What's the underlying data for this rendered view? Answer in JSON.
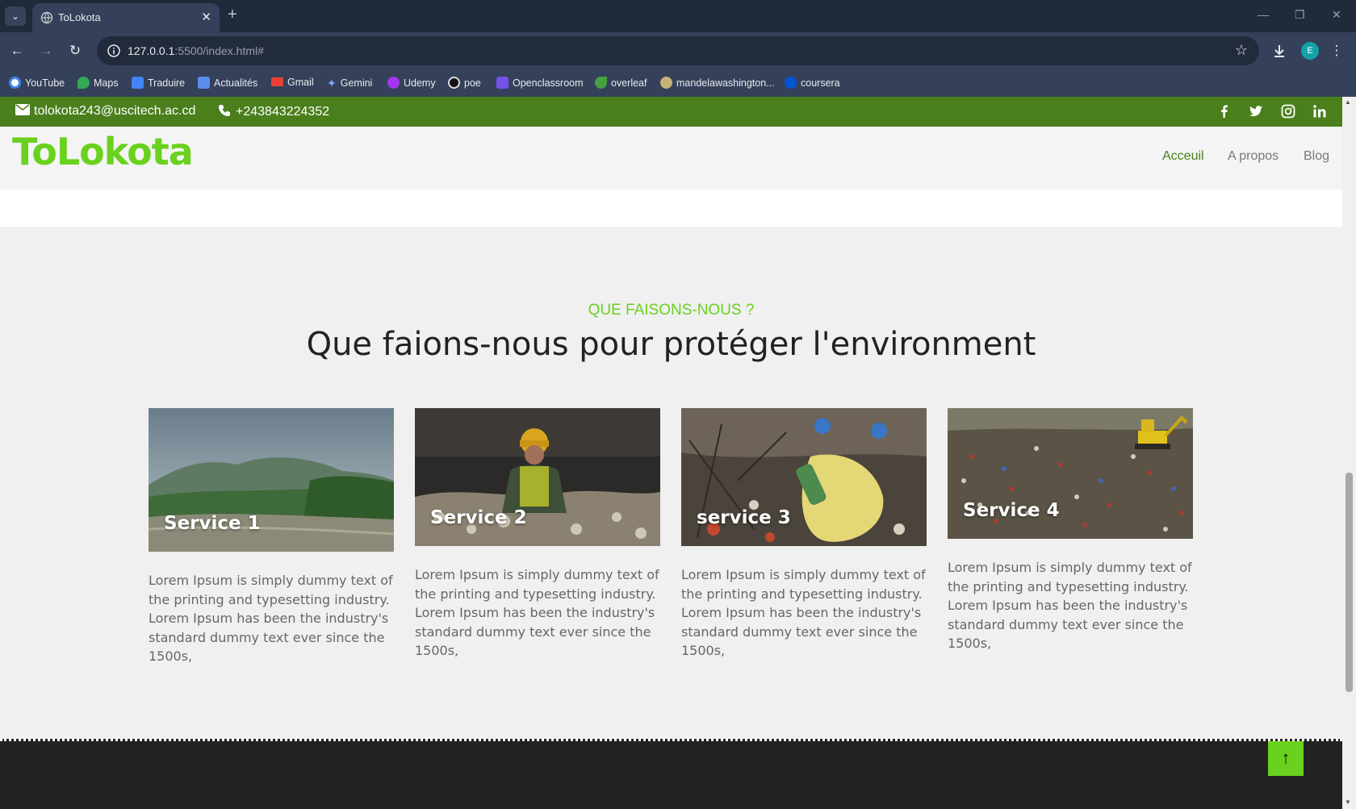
{
  "browser": {
    "tab_title": "ToLokota",
    "url_host": "127.0.0.1",
    "url_rest": ":5500/index.html#",
    "profile_initial": "E",
    "bookmarks": [
      "YouTube",
      "Maps",
      "Traduire",
      "Actualités",
      "Gmail",
      "Gemini",
      "Udemy",
      "poe",
      "Openclassroom",
      "overleaf",
      "mandelawashington...",
      "coursera"
    ]
  },
  "topbar": {
    "email": "tolokota243@uscitech.ac.cd",
    "phone": "+243843224352",
    "social_icons": [
      "facebook-icon",
      "twitter-icon",
      "instagram-icon",
      "linkedin-icon"
    ],
    "bg_color": "#4a7f1c"
  },
  "nav": {
    "logo": "ToLokota",
    "links": [
      "Acceuil",
      "A propos",
      "Blog"
    ],
    "active": "Acceuil"
  },
  "section": {
    "eyebrow": "QUE FAISONS-NOUS ?",
    "headline": "Que faions-nous pour protéger l'environment"
  },
  "services": [
    {
      "title": "Service 1",
      "text": "Lorem Ipsum is simply dummy text of the printing and typesetting industry. Lorem Ipsum has been the industry's standard dummy text ever since the 1500s,"
    },
    {
      "title": "Service 2",
      "text": "Lorem Ipsum is simply dummy text of the printing and typesetting industry. Lorem Ipsum has been the industry's standard dummy text ever since the 1500s,"
    },
    {
      "title": "service 3",
      "text": "Lorem Ipsum is simply dummy text of the printing and typesetting industry. Lorem Ipsum has been the industry's standard dummy text ever since the 1500s,"
    },
    {
      "title": "Service 4",
      "text": "Lorem Ipsum is simply dummy text of the printing and typesetting industry. Lorem Ipsum has been the industry's standard dummy text ever since the 1500s,"
    }
  ],
  "colors": {
    "accent": "#6ad11e",
    "dark_green": "#4a7f1c",
    "footer": "#222222"
  }
}
